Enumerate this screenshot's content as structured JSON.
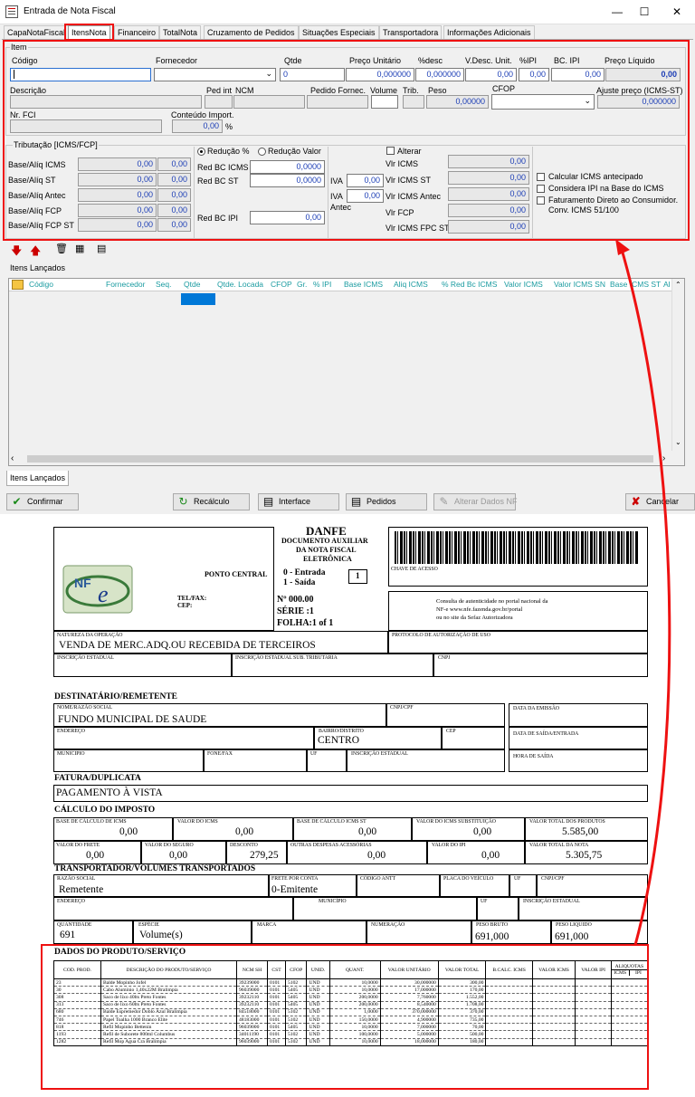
{
  "window": {
    "title": "Entrada de Nota Fiscal",
    "minimize": "—",
    "maximize": "☐",
    "close": "✕"
  },
  "tabs": [
    "CapaNotaFiscal",
    "ItensNota",
    "Financeiro",
    "TotalNota",
    "Cruzamento de Pedidos",
    "Situações Especiais",
    "Transportadora",
    "Informações Adicionais"
  ],
  "item": {
    "group": "Item",
    "labels": {
      "codigo": "Código",
      "fornecedor": "Fornecedor",
      "qtde": "Qtde",
      "preco_unit": "Preço Unitário",
      "desc": "%desc",
      "vdesc": "V.Desc. Unit.",
      "ipi": "%IPI",
      "bcipi": "BC. IPI",
      "preco_liq": "Preço Líquido",
      "descricao": "Descrição",
      "pedint": "Ped int",
      "ncm": "NCM",
      "pedforn": "Pedido Fornec.",
      "volume": "Volume",
      "trib": "Trib.",
      "peso": "Peso",
      "cfop": "CFOP",
      "ajuste": "Ajuste preço (ICMS-ST)",
      "nrfci": "Nr. FCI",
      "conteudo": "Conteúdo Import."
    },
    "values": {
      "qtde": "0",
      "preco_unit": "0,000000",
      "desc": "0,000000",
      "vdesc": "0,00",
      "ipi": "0,00",
      "bcipi": "0,00",
      "preco_liq": "0,00",
      "peso": "0,00000",
      "ajuste": "0,000000",
      "conteudo": "0,00",
      "pct": "%"
    }
  },
  "trib": {
    "group": "Tributação [ICMS/FCP]",
    "rows": [
      {
        "label": "Base/Alíq ICMS",
        "a": "0,00",
        "b": "0,00"
      },
      {
        "label": "Base/Alíq ST",
        "a": "0,00",
        "b": "0,00"
      },
      {
        "label": "Base/Alíq Antec",
        "a": "0,00",
        "b": "0,00"
      },
      {
        "label": "Base/Alíq FCP",
        "a": "0,00",
        "b": "0,00"
      },
      {
        "label": "Base/Alíq FCP ST",
        "a": "0,00",
        "b": "0,00"
      }
    ],
    "reducao_pct": "Redução %",
    "reducao_valor": "Redução Valor",
    "red_bc_icms": "Red BC ICMS",
    "red_bc_icms_val": "0,0000",
    "red_bc_st": "Red BC ST",
    "red_bc_st_val": "0,0000",
    "red_bc_ipi": "Red BC IPI",
    "red_bc_ipi_val": "0,00",
    "iva": "IVA",
    "iva_val": "0,00",
    "iva_antec": "IVA",
    "antec": "Antec",
    "iva_antec_val": "0,00",
    "alterar": "Alterar",
    "vlr": [
      {
        "label": "Vlr ICMS",
        "v": "0,00"
      },
      {
        "label": "Vlr ICMS ST",
        "v": "0,00"
      },
      {
        "label": "Vlr ICMS Antec",
        "v": "0,00"
      },
      {
        "label": "Vlr FCP",
        "v": "0,00"
      },
      {
        "label": "Vlr ICMS FPC ST",
        "v": "0,00"
      }
    ],
    "checks": [
      "Calcular ICMS antecipado",
      "Considera IPI na Base do ICMS",
      "Faturamento Direto ao Consumidor.",
      "Conv. ICMS 51/100"
    ]
  },
  "itens": {
    "group": "Itens Lançados",
    "columns": [
      "Código",
      "Fornecedor",
      "Seq.",
      "Qtde",
      "Qtde. Locada",
      "CFOP",
      "Gr.",
      "% IPI",
      "Base ICMS",
      "Aliq ICMS",
      "% Red Bc ICMS",
      "Valor ICMS",
      "Valor ICMS SN",
      "Base ICMS ST",
      "Al"
    ],
    "bottom_tab": "Itens Lançados"
  },
  "buttons": {
    "confirmar": "Confirmar",
    "recalculo": "Recálculo",
    "interface": "Interface",
    "pedidos": "Pedidos",
    "alterar": "Alterar Dados NF",
    "cancelar": "Cancelar"
  },
  "danfe": {
    "title": "DANFE",
    "sub1": "DOCUMENTO AUXILIAR",
    "sub2": "DA NOTA FISCAL",
    "sub3": "ELETRÔNICA",
    "entrada": "0 - Entrada",
    "saida": "1 - Saída",
    "tipo": "1",
    "numero": "Nº  000.00",
    "serie": "SÉRIE :1",
    "folha": "FOLHA:1 of 1",
    "emitente": "PONTO CENTRAL",
    "tel": "TEL/FAX:",
    "cep": "CEP:",
    "chave": "CHAVE DE ACESSO",
    "consulta1": "Consulta de autenticidade no portal  nacional da",
    "consulta2": "NF-e www.nfe.fazenda.gov.br/portal",
    "consulta3": "ou no site da Sefaz Autorizadora",
    "natureza_l": "NATUREZA DA OPERAÇÃO",
    "natureza": "VENDA DE MERC.ADQ.OU RECEBIDA DE TERCEIROS",
    "protocolo": "PROTOCOLO DE AUTORIZAÇÃO DE USO",
    "ie": "INSCRIÇÃO ESTADUAL",
    "iest": "INSCRIÇÃO ESTADUAL SUB. TRIBUTARIA",
    "cnpj": "CNPJ",
    "dest": "DESTINATÁRIO/REMETENTE",
    "razao_l": "NOME/RAZÃO SOCIAL",
    "razao": "FUNDO MUNICIPAL DE SAUDE",
    "cnpjcpf": "CNPJ/CPF",
    "emissao": "DATA DA EMISSÃO",
    "endereco": "ENDEREÇO",
    "bairro_l": "BAIRRO/DISTRITO",
    "bairro": "CENTRO",
    "cep_l": "CEP",
    "saida_l": "DATA DE SAÍDA/ENTRADA",
    "municipio": "MUNICIPIO",
    "fone": "FONE/FAX",
    "uf": "UF",
    "ie2": "INSCRIÇÃO ESTADUAL",
    "hora": "HORA DE SAÍDA",
    "fatura": "FATURA/DUPLICATA",
    "pagamento": "PAGAMENTO À VISTA",
    "calc": "CÁLCULO DO IMPOSTO",
    "imp1": [
      {
        "l": "BASE DE CÁLCULO DE ICMS",
        "v": "0,00"
      },
      {
        "l": "VALOR DO ICMS",
        "v": "0,00"
      },
      {
        "l": "BASE DE CÁLCULO ICMS ST",
        "v": "0,00"
      },
      {
        "l": "VALOR DO ICMS SUBSTITUIÇÃO",
        "v": "0,00"
      },
      {
        "l": "VALOR TOTAL DOS PRODUTOS",
        "v": "5.585,00"
      }
    ],
    "imp2": [
      {
        "l": "VALOR DO FRETE",
        "v": "0,00"
      },
      {
        "l": "VALOR DO SEGURO",
        "v": "0,00"
      },
      {
        "l": "DESCONTO",
        "v": "279,25"
      },
      {
        "l": "OUTRAS DESPESAS ACESSÓRIAS",
        "v": "0,00"
      },
      {
        "l": "VALOR DO IPI",
        "v": "0,00"
      },
      {
        "l": "VALOR TOTAL DA NOTA",
        "v": "5.305,75"
      }
    ],
    "transp": "TRANSPORTADOR/VOLUMES TRANSPORTADOS",
    "t_razao_l": "RAZÃO SOCIAL",
    "t_razao": "Remetente",
    "frete_l": "FRETE POR CONTA",
    "frete": "0-Emitente",
    "antt": "CÓDIGO ANTT",
    "placa": "PLACA DO VEÍCULO",
    "t_uf": "UF",
    "t_cnpj": "CNPJ/CPF",
    "t_end": "ENDEREÇO",
    "t_mun": "MUNICÍPIO",
    "t_uf2": "UF",
    "t_ie": "INSCRIÇÃO ESTADUAL",
    "qtd_l": "QUANTIDADE",
    "qtd": "691",
    "esp_l": "ESPÉCIE",
    "esp": "Volume(s)",
    "marca": "MARCA",
    "num": "NUMERAÇÃO",
    "pb_l": "PESO BRUTO",
    "pb": "691,000",
    "pl_l": "PESO LIQUIDO",
    "pl": "691,000",
    "prod_title": "DADOS DO PRODUTO/SERVIÇO",
    "cols": [
      "COD. PROD.",
      "DESCRIÇÃO DO PRODUTO/SERVIÇO",
      "NCM SH",
      "CST",
      "CFOP",
      "UNID.",
      "QUANT.",
      "VALOR UNITÁRIO",
      "VALOR TOTAL",
      "B.CALC. ICMS",
      "VALOR ICMS",
      "VALOR IPI",
      "ALIQUOTAS",
      "ICMS",
      "IPI"
    ],
    "rows": [
      [
        "23",
        "Balde Mopinho  Jofel",
        "39239000",
        "0101",
        "5102",
        "UND",
        "10,0000",
        "30,000000",
        "300,00"
      ],
      [
        "30",
        "Cabo Aluminio 1,40x22M  Bralimpia",
        "96039000",
        "0101",
        "5405",
        "UND",
        "10,0000",
        "17,000000",
        "170,00"
      ],
      [
        "308",
        "Saco de lixo 40lts Preto  Fontes",
        "39232110",
        "0101",
        "5405",
        "UND",
        "200,0000",
        "7,760000",
        "1.552,00"
      ],
      [
        "313",
        "Saco de lixo 60lts Preto  Fontes",
        "39232110",
        "0101",
        "5405",
        "UND",
        "200,0000",
        "8,540000",
        "1.708,00"
      ],
      [
        "680",
        "Balde Espremedor Doblo Azul  Bralimpia",
        "84518000",
        "0101",
        "5102",
        "UND",
        "1,0000",
        "370,000000",
        "370,00"
      ],
      [
        "746",
        "Papel Toalha 1000 Branco Elite",
        "48183000",
        "0101",
        "5102",
        "UND",
        "150,0000",
        "4,900000",
        "735,00"
      ],
      [
        "818",
        "Refil Mopinho  Bettenin",
        "96039000",
        "0101",
        "5405",
        "UND",
        "10,0000",
        "7,000000",
        "70,00"
      ],
      [
        "1193",
        "Refil de Suborete 800ml  Columbus",
        "34011190",
        "0101",
        "5102",
        "UND",
        "100,0000",
        "5,000000",
        "500,00"
      ],
      [
        "1282",
        "Refil Mop Agua Cra  Bralimpia",
        "96039000",
        "0101",
        "5102",
        "UND",
        "10,0000",
        "18,000000",
        "180,00"
      ]
    ]
  }
}
